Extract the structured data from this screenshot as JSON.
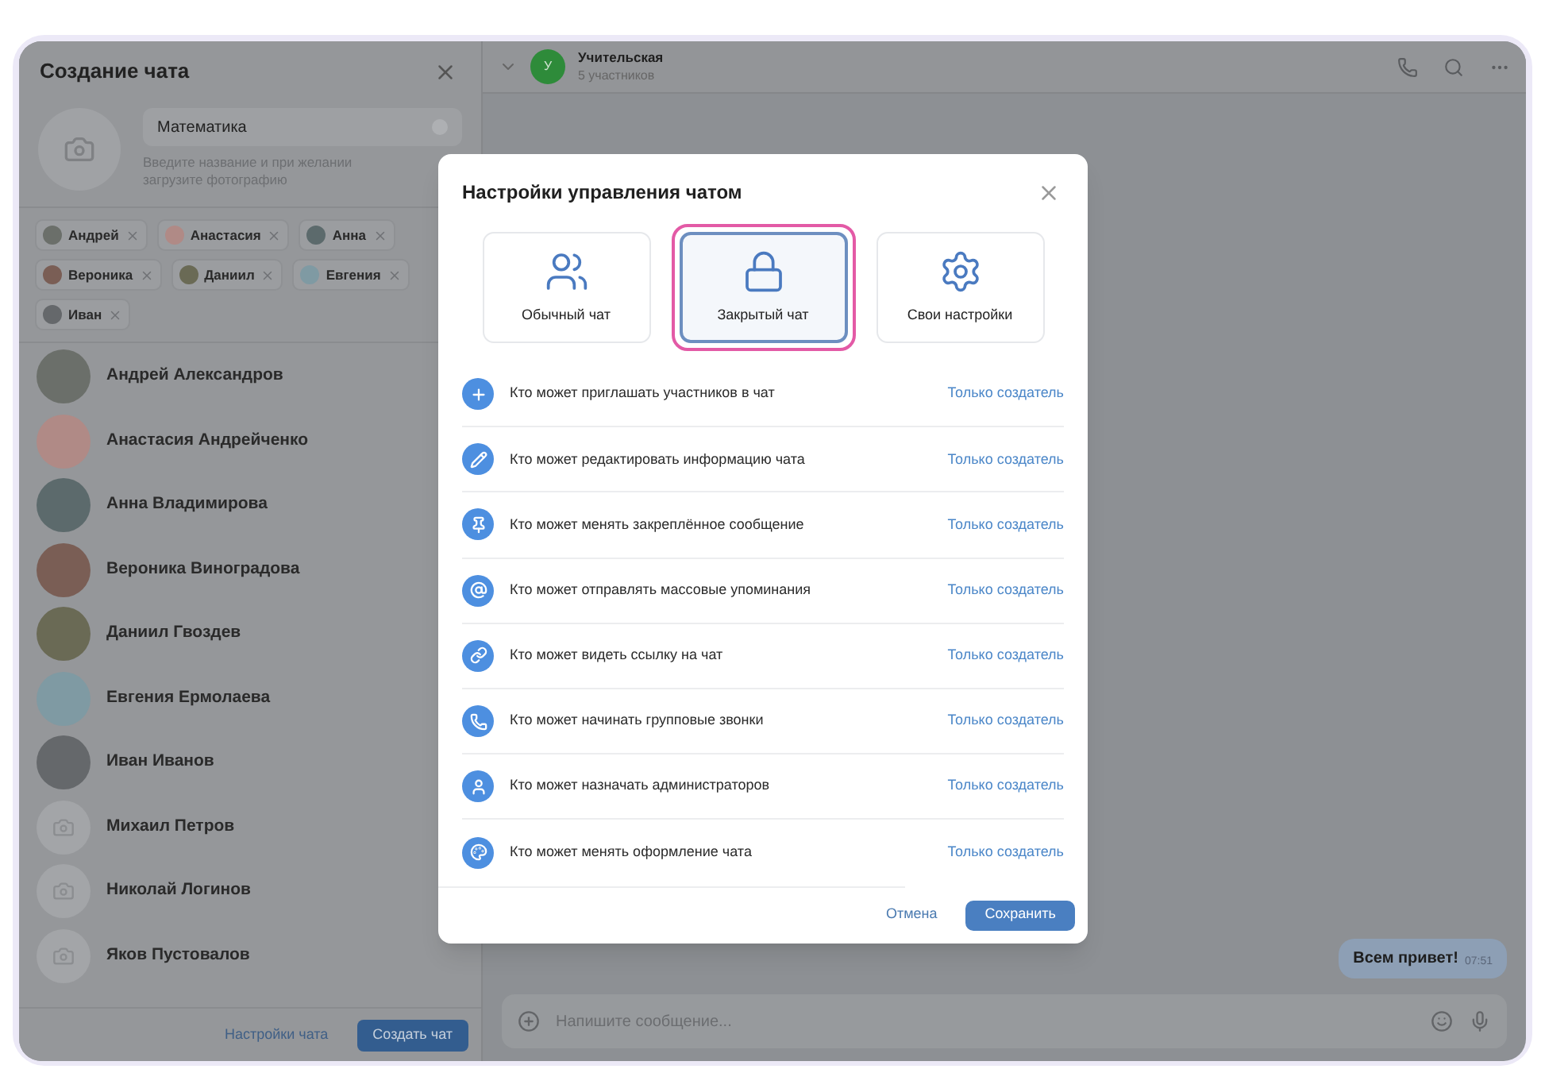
{
  "create_panel": {
    "title": "Создание чата",
    "name_field": {
      "value": "Математика"
    },
    "hint": "Введите название и при желании загрузите фотографию",
    "chips": [
      {
        "label": "Андрей"
      },
      {
        "label": "Анастасия"
      },
      {
        "label": "Анна"
      },
      {
        "label": "Вероника"
      },
      {
        "label": "Даниил"
      },
      {
        "label": "Евгения"
      },
      {
        "label": "Иван"
      }
    ],
    "contacts": [
      {
        "name": "Андрей Александров",
        "kind": "photo"
      },
      {
        "name": "Анастасия Андрейченко",
        "kind": "photo"
      },
      {
        "name": "Анна Владимирова",
        "kind": "photo"
      },
      {
        "name": "Вероника Виноградова",
        "kind": "photo"
      },
      {
        "name": "Даниил Гвоздев",
        "kind": "photo"
      },
      {
        "name": "Евгения Ермолаева",
        "kind": "photo"
      },
      {
        "name": "Иван Иванов",
        "kind": "photo"
      },
      {
        "name": "Михаил Петров",
        "kind": "placeholder"
      },
      {
        "name": "Николай Логинов",
        "kind": "placeholder"
      },
      {
        "name": "Яков Пустовалов",
        "kind": "placeholder"
      }
    ],
    "settings_link": "Настройки чата",
    "create_button": "Создать чат"
  },
  "chat": {
    "avatar_letter": "У",
    "title": "Учительская",
    "subtitle": "5 участников",
    "message": {
      "text": "Всем привет!",
      "time": "07:51"
    },
    "input": {
      "placeholder": "Напишите сообщение..."
    }
  },
  "dialog": {
    "title": "Настройки управления чатом",
    "options": [
      {
        "label": "Обычный чат",
        "selected": false
      },
      {
        "label": "Закрытый чат",
        "selected": true
      },
      {
        "label": "Свои настройки",
        "selected": false
      }
    ],
    "settings": [
      {
        "label": "Кто может приглашать участников в чат",
        "value": "Только создатель"
      },
      {
        "label": "Кто может редактировать информацию чата",
        "value": "Только создатель"
      },
      {
        "label": "Кто может менять закреплённое сообщение",
        "value": "Только создатель"
      },
      {
        "label": "Кто может отправлять массовые упоминания",
        "value": "Только создатель"
      },
      {
        "label": "Кто может видеть ссылку на чат",
        "value": "Только создатель"
      },
      {
        "label": "Кто может начинать групповые звонки",
        "value": "Только создатель"
      },
      {
        "label": "Кто может назначать администраторов",
        "value": "Только создатель"
      },
      {
        "label": "Кто может менять оформление чата",
        "value": "Только создатель"
      }
    ],
    "cancel": "Отмена",
    "save": "Сохранить"
  }
}
